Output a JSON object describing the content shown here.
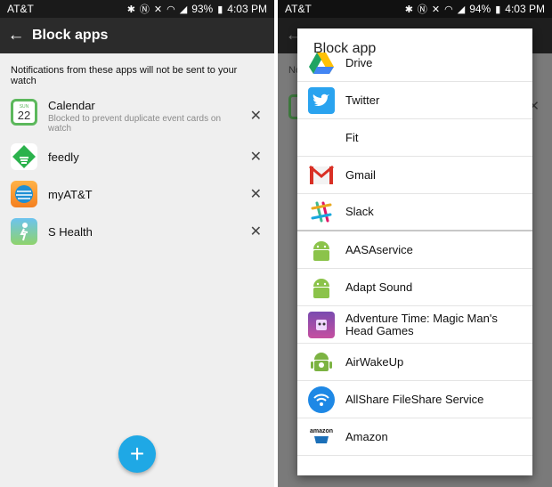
{
  "status_left": {
    "carrier": "AT&T",
    "battery": "93%",
    "time": "4:03 PM"
  },
  "status_right": {
    "carrier": "AT&T",
    "battery": "94%",
    "time": "4:03 PM"
  },
  "left_screen": {
    "title": "Block apps",
    "notice": "Notifications from these apps will not be sent to your watch",
    "apps": [
      {
        "name": "Calendar",
        "subtitle": "Blocked to prevent duplicate event cards on watch",
        "icon": "calendar-icon",
        "icon_day": "22",
        "icon_month": "SUN"
      },
      {
        "name": "feedly",
        "icon": "feedly-icon"
      },
      {
        "name": "myAT&T",
        "icon": "myatt-icon"
      },
      {
        "name": "S Health",
        "icon": "s-health-icon"
      }
    ]
  },
  "right_screen": {
    "background_fragments": {
      "notice": "No"
    },
    "dialog": {
      "title": "Block app",
      "apps": [
        {
          "name": "Drive",
          "icon": "drive-icon"
        },
        {
          "name": "Twitter",
          "icon": "twitter-icon"
        },
        {
          "name": "Fit",
          "icon": "none"
        },
        {
          "name": "Gmail",
          "icon": "gmail-icon"
        },
        {
          "name": "Slack",
          "icon": "slack-icon"
        },
        {
          "name": "AASAservice",
          "icon": "android-icon"
        },
        {
          "name": "Adapt Sound",
          "icon": "android-icon"
        },
        {
          "name": "Adventure Time: Magic Man's Head Games",
          "icon": "adventure-time-icon"
        },
        {
          "name": "AirWakeUp",
          "icon": "airwakeup-icon"
        },
        {
          "name": "AllShare FileShare Service",
          "icon": "allshare-icon"
        },
        {
          "name": "Amazon",
          "icon": "amazon-icon",
          "icon_text": "amazon"
        }
      ]
    }
  },
  "colors": {
    "fab": "#1fa8e5",
    "appbar": "#2b2b2b",
    "background": "#efefef"
  }
}
